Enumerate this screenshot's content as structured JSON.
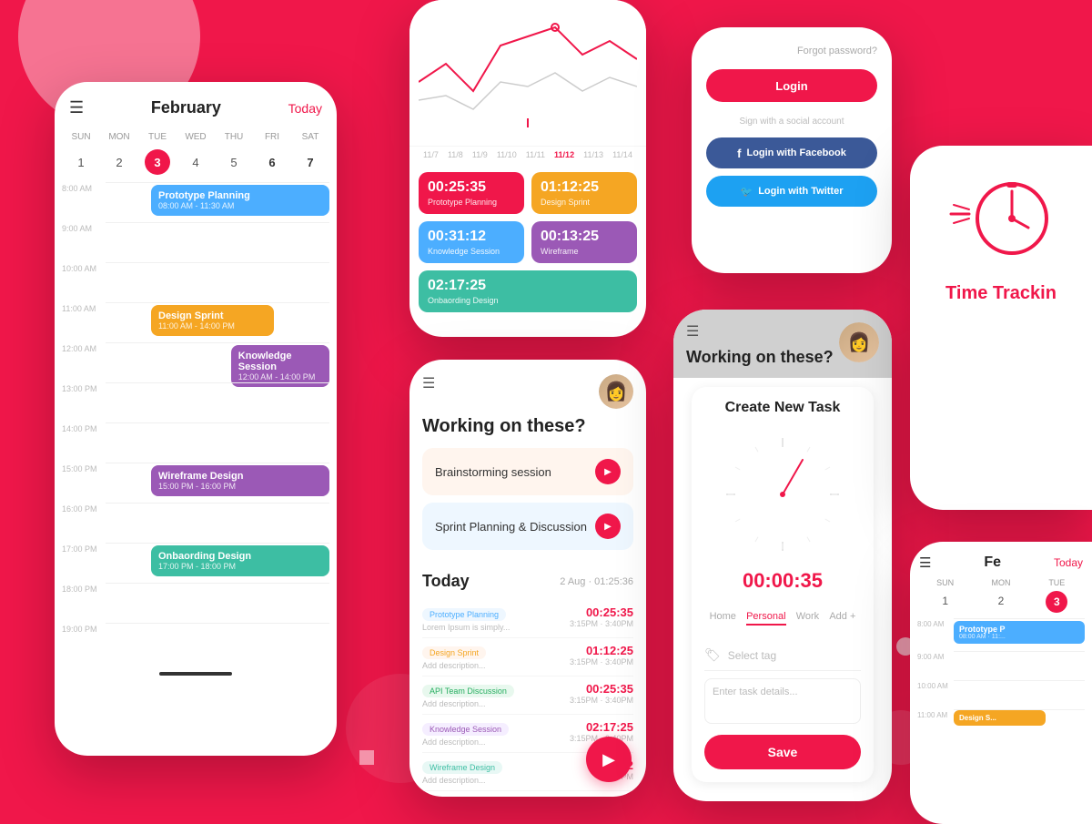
{
  "background": {
    "color": "#F0174A"
  },
  "phone_calendar": {
    "month": "February",
    "today_btn": "Today",
    "days": [
      "SUN",
      "MON",
      "TUE",
      "WED",
      "THU",
      "FRI",
      "SAT"
    ],
    "dates": [
      "1",
      "2",
      "3",
      "4",
      "5",
      "6",
      "7"
    ],
    "active_date": "3",
    "times": [
      "8:00 AM",
      "9:00 AM",
      "10:00 AM",
      "11:00 AM",
      "12:00 AM",
      "13:00 PM",
      "14:00 PM",
      "15:00 PM",
      "16:00 PM",
      "17:00 PM",
      "18:00 PM",
      "19:00 PM"
    ],
    "events": [
      {
        "title": "Prototype Planning",
        "time": "08:00 AM - 11:30 AM",
        "color": "blue"
      },
      {
        "title": "Design Sprint",
        "time": "11:00 AM - 14:00 PM",
        "color": "orange"
      },
      {
        "title": "Knowledge Session",
        "time": "12:00 AM - 14:00 PM",
        "color": "purple"
      },
      {
        "title": "Wireframe Design",
        "time": "15:00 PM - 16:00 PM",
        "color": "purple"
      },
      {
        "title": "Onbaording Design",
        "time": "17:00 PM - 18:00 PM",
        "color": "teal"
      }
    ]
  },
  "phone_tracker": {
    "dates": [
      "11/7",
      "11/8",
      "11/9",
      "11/10",
      "11/11",
      "11/12",
      "11/13",
      "11/14"
    ],
    "active_date": "11/12",
    "blocks": [
      {
        "value": "00:25:35",
        "label": "Prototype Planning",
        "color": "pink"
      },
      {
        "value": "01:12:25",
        "label": "Design Sprint",
        "color": "orange"
      },
      {
        "value": "00:31:12",
        "label": "Knowledge Session",
        "color": "blue"
      },
      {
        "value": "00:13:25",
        "label": "Wireframe",
        "color": "purple"
      },
      {
        "value": "02:17:25",
        "label": "Onbaording Design",
        "color": "teal"
      }
    ]
  },
  "phone_login": {
    "forgot_password": "Forgot password?",
    "login_btn": "Login",
    "divider": "Sign with a social account",
    "facebook_btn": "Login with Facebook",
    "twitter_btn": "Login with Twitter"
  },
  "phone_working": {
    "title": "Working on these?",
    "tasks": [
      {
        "name": "Brainstorming session",
        "bg": "orange"
      },
      {
        "name": "Sprint Planning & Discussion",
        "bg": "blue"
      }
    ],
    "today_label": "Today",
    "today_date": "2 Aug · 01:25:36",
    "today_items": [
      {
        "tag": "Prototype Planning",
        "tag_color": "blue",
        "desc": "Lorem Ipsum is simply...",
        "time": "00:25:35",
        "range": "3:15PM · 3:40PM"
      },
      {
        "tag": "Design Sprint",
        "tag_color": "orange",
        "desc": "Add description...",
        "time": "01:12:25",
        "range": "3:15PM · 3:40PM"
      },
      {
        "tag": "API Team Discussion",
        "tag_color": "green",
        "desc": "Add description...",
        "time": "00:25:35",
        "range": "3:15PM · 3:40PM"
      },
      {
        "tag": "Knowledge Session",
        "tag_color": "purple",
        "desc": "Add description...",
        "time": "02:17:25",
        "range": "3:15PM · 3:40PM"
      },
      {
        "tag": "Wireframe Design",
        "tag_color": "teal",
        "desc": "Add description...",
        "time": "02",
        "range": "3:15PM"
      }
    ]
  },
  "phone_task": {
    "working_title": "Working on these?",
    "create_title": "Create  New Task",
    "timer_display": "00:00",
    "timer_seconds": ":35",
    "tabs": [
      "Home",
      "Personal",
      "Work",
      "Add +"
    ],
    "active_tab": "Personal",
    "select_tag": "Select tag",
    "task_details_placeholder": "Enter task details...",
    "save_btn": "Save"
  },
  "phone_time_tracking": {
    "label_time": "Time",
    "label_tracking": "Trackin"
  },
  "phone_calendar_right": {
    "month": "Fe",
    "days": [
      "SUN",
      "MON",
      "TUE"
    ],
    "dates": [
      "1",
      "2",
      "3"
    ],
    "times": [
      "8:00 AM",
      "9:00 AM",
      "10:00 AM",
      "11:00 AM"
    ],
    "event_title": "Prototype P",
    "event_time": "08:00 AM · 11:..."
  }
}
